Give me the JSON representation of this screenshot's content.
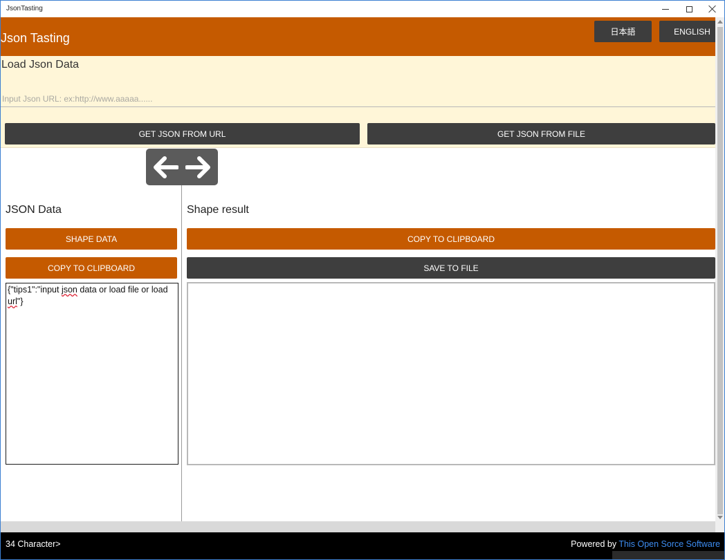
{
  "window": {
    "title": "JsonTasting"
  },
  "header": {
    "app_title": "Json Tasting",
    "lang_japanese": "日本語",
    "lang_english": "ENGLISH"
  },
  "load": {
    "title": "Load Json Data",
    "url_placeholder": "Input Json URL: ex:http://www.aaaaa......",
    "url_value": "",
    "get_from_url": "GET JSON FROM URL",
    "get_from_file": "GET JSON FROM FILE"
  },
  "left_pane": {
    "title": "JSON Data",
    "shape_button": "SHAPE DATA",
    "copy_button": "COPY TO CLIPBOARD",
    "json_text_parts": [
      "{\"tips1\":\"input ",
      "json",
      " data or load file or load ",
      "url",
      "\"}"
    ]
  },
  "right_pane": {
    "title": "Shape result",
    "copy_button": "COPY TO CLIPBOARD",
    "save_button": "SAVE TO FILE",
    "result_text": ""
  },
  "status": {
    "char_count": "34 Character>",
    "powered_by": "Powered by ",
    "link_text": "This Open Sorce Software"
  },
  "colors": {
    "accent": "#c55a00",
    "dark_button": "#3e3e3e",
    "load_background": "#fff6d8",
    "link": "#3d8cf0"
  },
  "icons": {
    "back": "arrow-left-icon",
    "forward": "arrow-right-icon",
    "minimize": "minimize-icon",
    "maximize": "maximize-icon",
    "close": "close-icon"
  }
}
